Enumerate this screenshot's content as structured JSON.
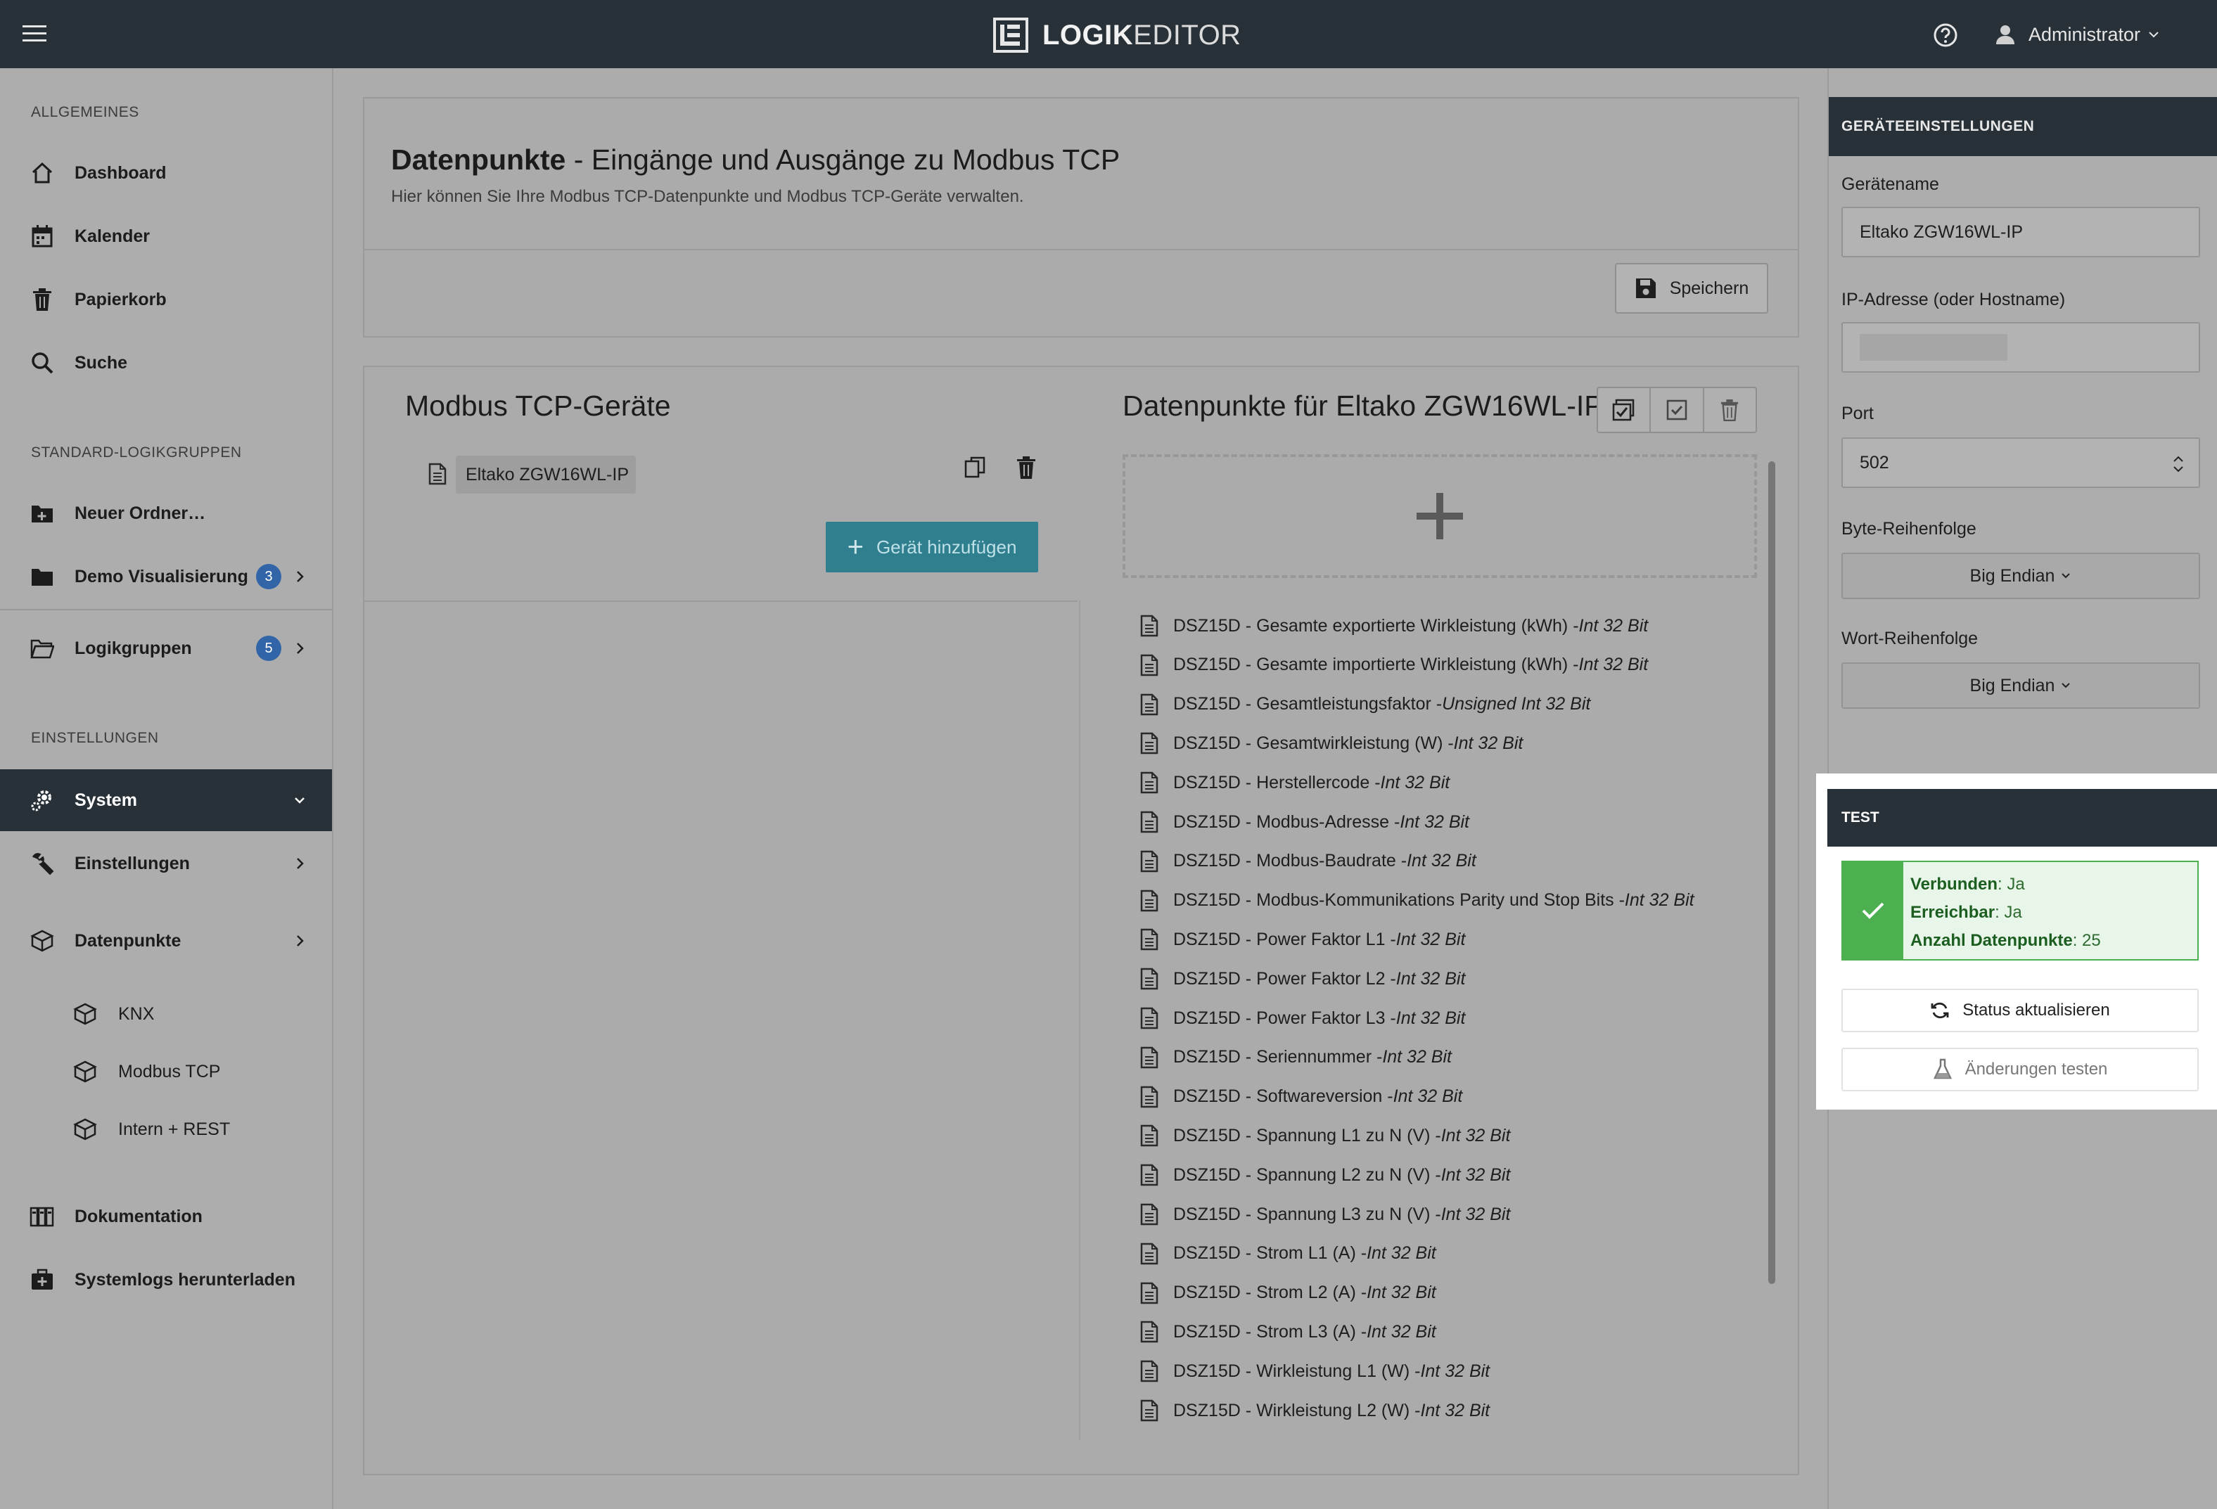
{
  "header": {
    "logo_bold": "LOGIK",
    "logo_light": "EDITOR",
    "user_name": "Administrator"
  },
  "sidebar": {
    "section_general": "ALLGEMEINES",
    "general_items": [
      "Dashboard",
      "Kalender",
      "Papierkorb",
      "Suche"
    ],
    "section_groups": "STANDARD-LOGIKGRUPPEN",
    "new_folder": "Neuer Ordner…",
    "demo_vis": "Demo Visualisierung",
    "demo_vis_badge": "3",
    "logic_groups": "Logikgruppen",
    "logic_groups_badge": "5",
    "section_settings": "EINSTELLUNGEN",
    "system": "System",
    "settings": "Einstellungen",
    "datapoints": "Datenpunkte",
    "sub_knx": "KNX",
    "sub_modbus": "Modbus TCP",
    "sub_rest": "Intern + REST",
    "documentation": "Dokumentation",
    "download_logs": "Systemlogs herunterladen"
  },
  "main": {
    "title_bold": "Datenpunkte",
    "title_rest": " - Eingänge und Ausgänge zu Modbus TCP",
    "subtitle": "Hier können Sie Ihre Modbus TCP-Datenpunkte und Modbus TCP-Geräte verwalten.",
    "save_label": "Speichern",
    "devices_title": "Modbus TCP-Geräte",
    "device_name": "Eltako ZGW16WL-IP",
    "add_device_label": "Gerät hinzufügen",
    "datapoints_title": "Datenpunkte für Eltako ZGW16WL-IP",
    "datapoints": [
      {
        "name": "DSZ15D - Gesamte exportierte Wirkleistung (kWh) - ",
        "type": "Int 32 Bit"
      },
      {
        "name": "DSZ15D - Gesamte importierte Wirkleistung (kWh) - ",
        "type": "Int 32 Bit"
      },
      {
        "name": "DSZ15D - Gesamtleistungsfaktor - ",
        "type": "Unsigned Int 32 Bit"
      },
      {
        "name": "DSZ15D - Gesamtwirkleistung (W) - ",
        "type": "Int 32 Bit"
      },
      {
        "name": "DSZ15D - Herstellercode - ",
        "type": "Int 32 Bit"
      },
      {
        "name": "DSZ15D - Modbus-Adresse - ",
        "type": "Int 32 Bit"
      },
      {
        "name": "DSZ15D - Modbus-Baudrate - ",
        "type": "Int 32 Bit"
      },
      {
        "name": "DSZ15D - Modbus-Kommunikations Parity und Stop Bits - ",
        "type": "Int 32 Bit"
      },
      {
        "name": "DSZ15D - Power Faktor L1 - ",
        "type": "Int 32 Bit"
      },
      {
        "name": "DSZ15D - Power Faktor L2 - ",
        "type": "Int 32 Bit"
      },
      {
        "name": "DSZ15D - Power Faktor L3 - ",
        "type": "Int 32 Bit"
      },
      {
        "name": "DSZ15D - Seriennummer - ",
        "type": "Int 32 Bit"
      },
      {
        "name": "DSZ15D - Softwareversion - ",
        "type": "Int 32 Bit"
      },
      {
        "name": "DSZ15D - Spannung L1 zu N (V) - ",
        "type": "Int 32 Bit"
      },
      {
        "name": "DSZ15D - Spannung L2 zu N (V) - ",
        "type": "Int 32 Bit"
      },
      {
        "name": "DSZ15D - Spannung L3 zu N (V) - ",
        "type": "Int 32 Bit"
      },
      {
        "name": "DSZ15D - Strom L1 (A) - ",
        "type": "Int 32 Bit"
      },
      {
        "name": "DSZ15D - Strom L2 (A) - ",
        "type": "Int 32 Bit"
      },
      {
        "name": "DSZ15D - Strom L3 (A) - ",
        "type": "Int 32 Bit"
      },
      {
        "name": "DSZ15D - Wirkleistung L1 (W) - ",
        "type": "Int 32 Bit"
      },
      {
        "name": "DSZ15D - Wirkleistung L2 (W) - ",
        "type": "Int 32 Bit"
      }
    ]
  },
  "device_settings": {
    "header": "GERÄTEEINSTELLUNGEN",
    "name_label": "Gerätename",
    "name_value": "Eltako ZGW16WL-IP",
    "ip_label": "IP-Adresse (oder Hostname)",
    "port_label": "Port",
    "port_value": "502",
    "byte_order_label": "Byte-Reihenfolge",
    "byte_order_value": "Big Endian",
    "word_order_label": "Wort-Reihenfolge",
    "word_order_value": "Big Endian"
  },
  "test": {
    "header": "TEST",
    "connected_label": "Verbunden",
    "connected_value": ": Ja",
    "reachable_label": "Erreichbar",
    "reachable_value": ": Ja",
    "count_label": "Anzahl Datenpunkte",
    "count_value": ": 25",
    "refresh_label": "Status aktualisieren",
    "test_label": "Änderungen testen"
  },
  "colors": {
    "topbar": "#283138",
    "accent_button": "#2f7f8f",
    "badge": "#3264a8",
    "success": "#4caf50"
  }
}
